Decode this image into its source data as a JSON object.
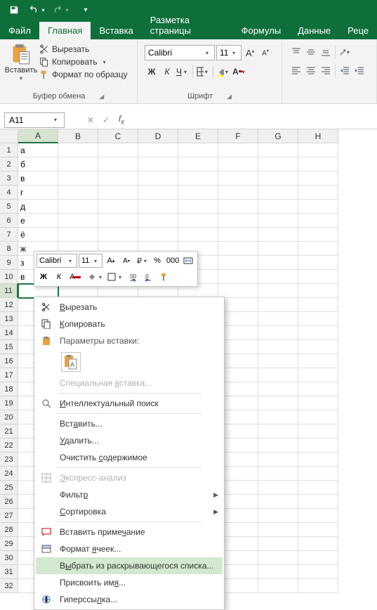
{
  "qa": {
    "save": "save",
    "undo": "undo",
    "redo": "redo",
    "customize": "customize"
  },
  "tabs": [
    "Файл",
    "Главная",
    "Вставка",
    "Разметка страницы",
    "Формулы",
    "Данные",
    "Реце"
  ],
  "activeTab": 1,
  "ribbon": {
    "clipboard": {
      "paste": "Вставить",
      "cut": "Вырезать",
      "copy": "Копировать",
      "formatPainter": "Формат по образцу",
      "label": "Буфер обмена"
    },
    "font": {
      "name": "Calibri",
      "size": "11",
      "bold": "Ж",
      "italic": "К",
      "underline": "Ч",
      "label": "Шрифт"
    }
  },
  "nameBox": "A11",
  "columns": [
    "A",
    "B",
    "C",
    "D",
    "E",
    "F",
    "G",
    "H"
  ],
  "rows": [
    {
      "n": "1",
      "v": "а"
    },
    {
      "n": "2",
      "v": "б"
    },
    {
      "n": "3",
      "v": "в"
    },
    {
      "n": "4",
      "v": "г"
    },
    {
      "n": "5",
      "v": "д"
    },
    {
      "n": "6",
      "v": "е"
    },
    {
      "n": "7",
      "v": "ё"
    },
    {
      "n": "8",
      "v": "ж"
    },
    {
      "n": "9",
      "v": "з"
    },
    {
      "n": "10",
      "v": "в"
    },
    {
      "n": "11",
      "v": ""
    },
    {
      "n": "12",
      "v": ""
    },
    {
      "n": "13",
      "v": ""
    },
    {
      "n": "14",
      "v": ""
    },
    {
      "n": "15",
      "v": ""
    },
    {
      "n": "16",
      "v": ""
    },
    {
      "n": "17",
      "v": ""
    },
    {
      "n": "18",
      "v": ""
    },
    {
      "n": "19",
      "v": ""
    },
    {
      "n": "20",
      "v": ""
    },
    {
      "n": "21",
      "v": ""
    },
    {
      "n": "22",
      "v": ""
    },
    {
      "n": "23",
      "v": ""
    },
    {
      "n": "24",
      "v": ""
    },
    {
      "n": "25",
      "v": ""
    },
    {
      "n": "26",
      "v": ""
    },
    {
      "n": "27",
      "v": ""
    },
    {
      "n": "28",
      "v": ""
    },
    {
      "n": "29",
      "v": ""
    },
    {
      "n": "30",
      "v": ""
    },
    {
      "n": "31",
      "v": ""
    },
    {
      "n": "32",
      "v": ""
    }
  ],
  "activeRow": 10,
  "mini": {
    "font": "Calibri",
    "size": "11",
    "bold": "Ж",
    "italic": "К",
    "percent": "%",
    "thousands": "000"
  },
  "ctx": {
    "cut": "Вырезать",
    "copy": "Копировать",
    "pasteHeader": "Параметры вставки:",
    "pasteSpecial": "Специальная вставка...",
    "smartLookup": "Интеллектуальный поиск",
    "insert": "Вставить...",
    "delete": "Удалить...",
    "clear": "Очистить содержимое",
    "quick": "Экспресс-анализ",
    "filter": "Фильтр",
    "sort": "Сортировка",
    "comment": "Вставить примечание",
    "format": "Формат ячеек...",
    "dropdown": "Выбрать из раскрывающегося списка...",
    "defineName": "Присвоить имя...",
    "hyperlink": "Гиперссылка..."
  }
}
